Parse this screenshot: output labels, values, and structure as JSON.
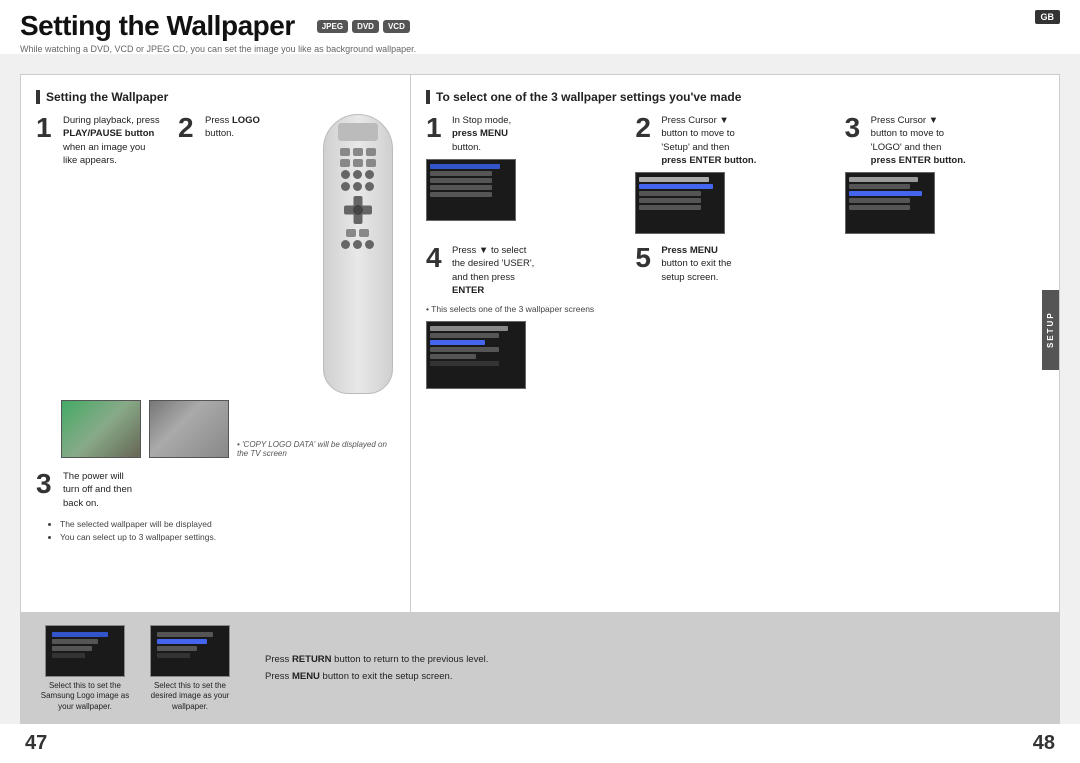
{
  "page": {
    "title": "Setting the Wallpaper",
    "badges": [
      "JPEG",
      "DVD",
      "VCD"
    ],
    "gb_label": "GB",
    "subtitle": "While watching a DVD, VCD or JPEG CD, you can set the image you like as background wallpaper."
  },
  "left_section": {
    "header": "Setting the Wallpaper",
    "steps": [
      {
        "number": "1",
        "text_line1": "During playback, press",
        "text_line2": "PLAY/PAUSE button",
        "text_line3": "when an image you",
        "text_line4": "like appears."
      },
      {
        "number": "2",
        "text_line1": "Press ",
        "text_bold": "LOGO",
        "text_line2": "button."
      },
      {
        "number": "3",
        "text_line1": "The power will",
        "text_line2": "turn off and then",
        "text_line3": "back on."
      }
    ],
    "copy_logo_note": "• 'COPY LOGO DATA' will be displayed on the TV screen",
    "bullet_notes": [
      "The selected wallpaper will be displayed",
      "You can select up to 3 wallpaper settings."
    ]
  },
  "right_section": {
    "header": "To select one of the 3 wallpaper settings you've made",
    "steps": [
      {
        "number": "1",
        "text_line1": "In Stop mode,",
        "text_bold": "press MENU",
        "text_line2": "button."
      },
      {
        "number": "2",
        "text_line1": "Press Cursor ▼",
        "text_line2": "button to move to",
        "text_line3": "'Setup' and then",
        "text_bold2": "press ENTER button."
      },
      {
        "number": "3",
        "text_line1": "Press Cursor ▼",
        "text_line2": "button to move to",
        "text_line3": "'LOGO' and then",
        "text_bold2": "press ENTER button."
      },
      {
        "number": "4",
        "text_line1": "Press ▼ to select",
        "text_line2": "the desired 'USER',",
        "text_line3": "and then press",
        "text_bold": "ENTER"
      },
      {
        "number": "5",
        "text_bold": "Press MENU",
        "text_line1": "button to exit the",
        "text_line2": "setup screen."
      }
    ],
    "bullet_note": "• This selects one of the 3 wallpaper screens",
    "setup_tab": "SETUP"
  },
  "bottom_section": {
    "thumb1_label": "Select this to set the Samsung Logo image as your wallpaper.",
    "thumb2_label": "Select this to set the desired image as your wallpaper.",
    "note1_prefix": "Press ",
    "note1_bold": "RETURN",
    "note1_suffix": " button to return to the previous level.",
    "note2_prefix": "Press ",
    "note2_bold": "MENU",
    "note2_suffix": " button to exit the setup screen."
  },
  "page_numbers": {
    "left": "47",
    "right": "48"
  }
}
